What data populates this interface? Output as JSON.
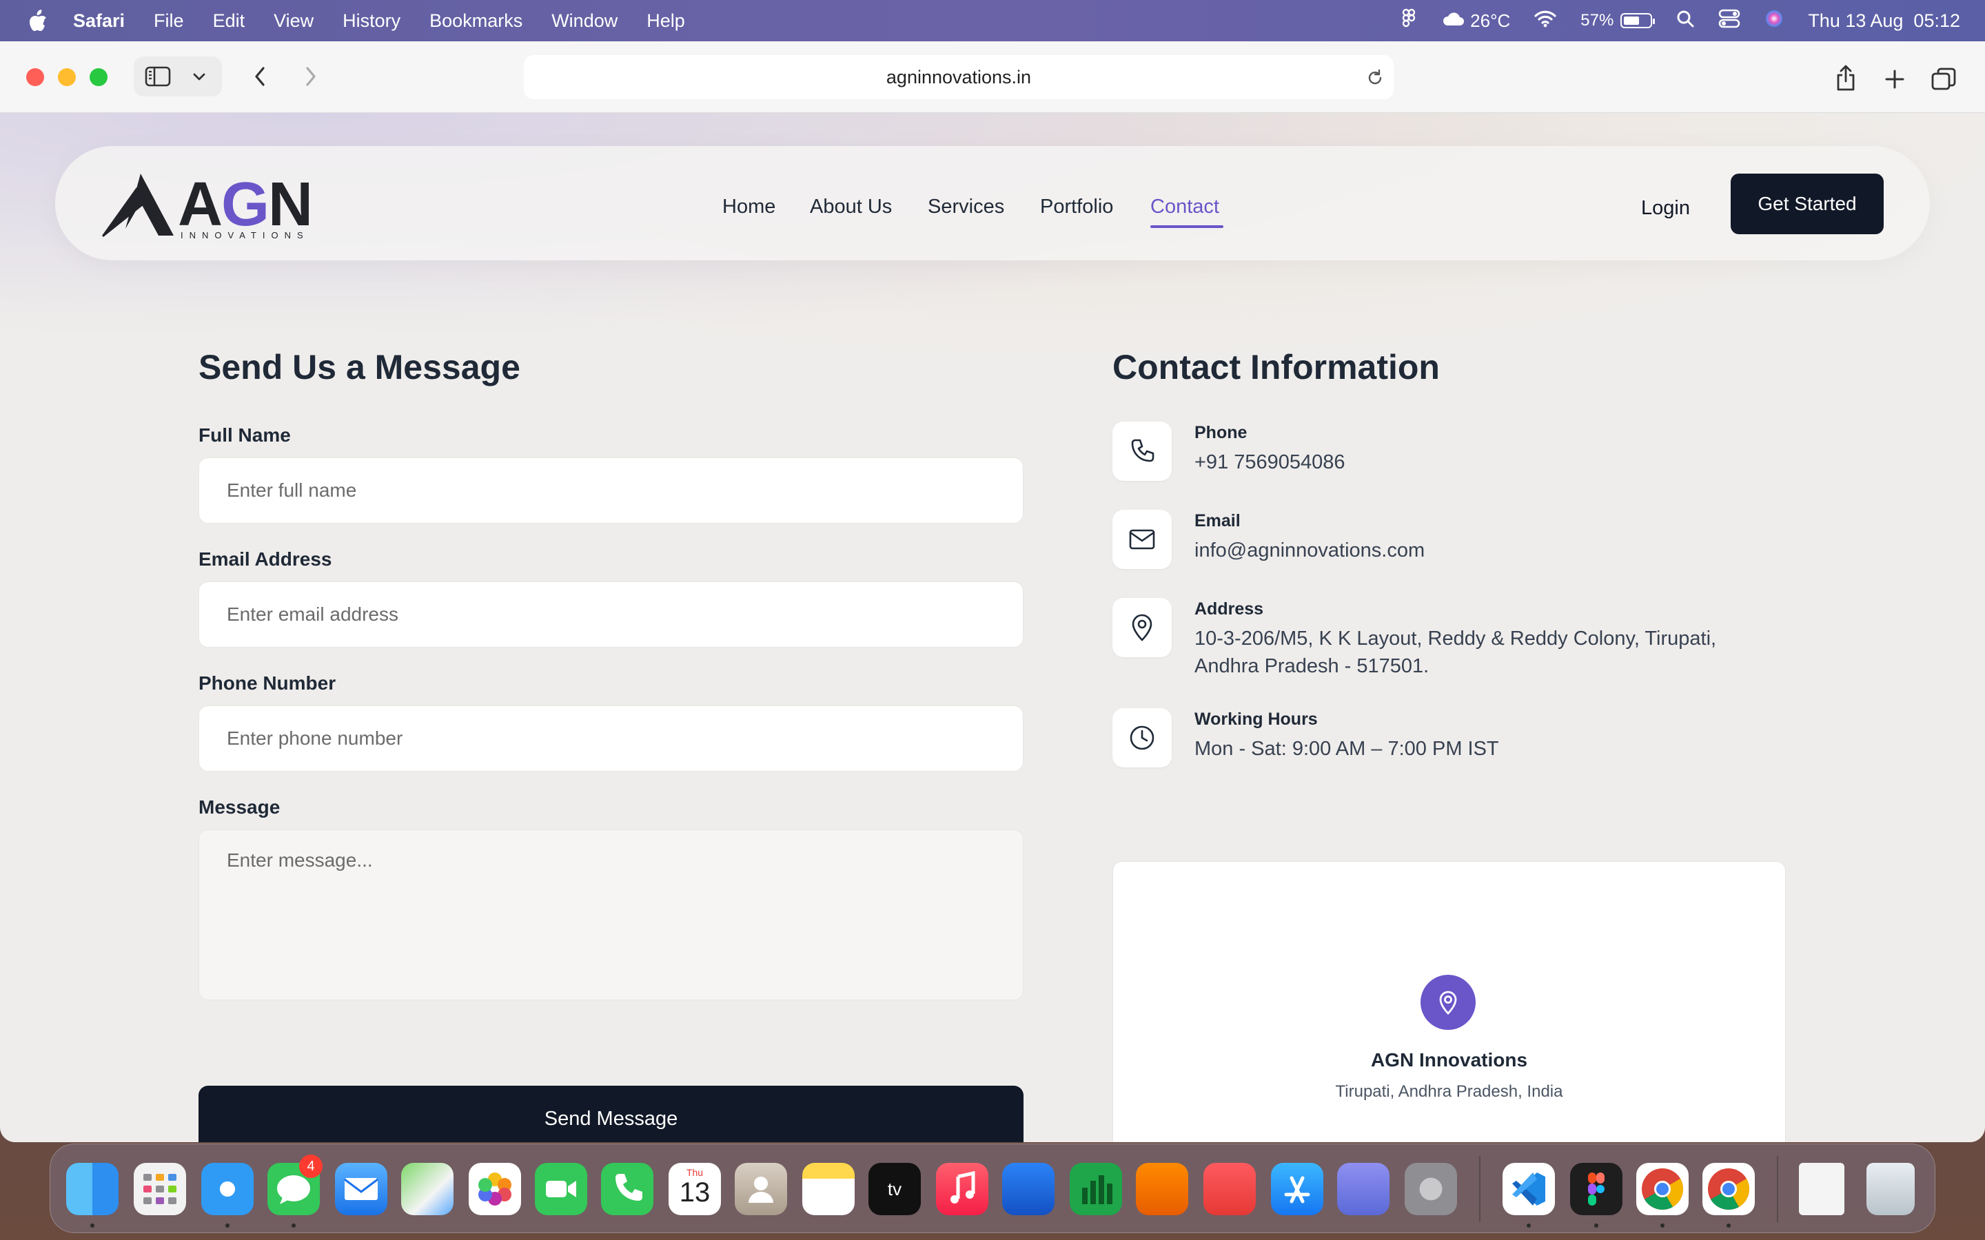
{
  "menubar": {
    "app_name": "Safari",
    "items": [
      "File",
      "Edit",
      "View",
      "History",
      "Bookmarks",
      "Window",
      "Help"
    ],
    "weather": "26°C",
    "battery_percent": "57%",
    "battery_level": 0.57,
    "datetime": "Thu 13 Aug  05:12"
  },
  "browser": {
    "url": "agninnovations.in"
  },
  "site": {
    "logo_word": "AGN",
    "logo_sub": "INNOVATIONS",
    "nav": [
      "Home",
      "About Us",
      "Services",
      "Portfolio",
      "Contact"
    ],
    "nav_active": "Contact",
    "login_label": "Login",
    "cta_label": "Get Started"
  },
  "form": {
    "title": "Send Us a Message",
    "full_name_label": "Full Name",
    "full_name_placeholder": "Enter full name",
    "email_label": "Email Address",
    "email_placeholder": "Enter email address",
    "phone_label": "Phone Number",
    "phone_placeholder": "Enter phone number",
    "message_label": "Message",
    "message_placeholder": "Enter message...",
    "submit_label": "Send Message"
  },
  "contact": {
    "title": "Contact Information",
    "phone_label": "Phone",
    "phone_value": "+91 7569054086",
    "email_label": "Email",
    "email_value": "info@agninnovations.com",
    "address_label": "Address",
    "address_line1": "10-3-206/M5, K K Layout, Reddy & Reddy Colony, Tirupati,",
    "address_line2": "Andhra Pradesh - 517501.",
    "hours_label": "Working Hours",
    "hours_value": "Mon - Sat: 9:00 AM – 7:00 PM IST"
  },
  "map": {
    "title": "AGN Innovations",
    "subtitle": "Tirupati, Andhra Pradesh, India"
  },
  "dock": {
    "messages_badge": "4",
    "calendar_day_label": "Thu",
    "calendar_day_number": "13",
    "tv_label": "tv",
    "apps": [
      "finder-icon",
      "launchpad-icon",
      "safari-icon",
      "messages-icon",
      "mail-icon",
      "maps-icon",
      "photos-icon",
      "facetime-icon",
      "phone-icon",
      "calendar-icon",
      "contacts-icon",
      "notes-icon",
      "apple-tv-icon",
      "music-icon",
      "keynote-icon",
      "numbers-icon",
      "pages-icon",
      "rocket-icon",
      "app-store-icon",
      "simulator-icon",
      "system-settings-icon",
      "vscode-icon",
      "figma-icon",
      "chrome-icon",
      "chrome-alt-icon",
      "document-icon",
      "trash-icon"
    ]
  },
  "colors": {
    "accent": "#6a55c9",
    "dark": "#111827",
    "page_bg": "#efedeb"
  }
}
